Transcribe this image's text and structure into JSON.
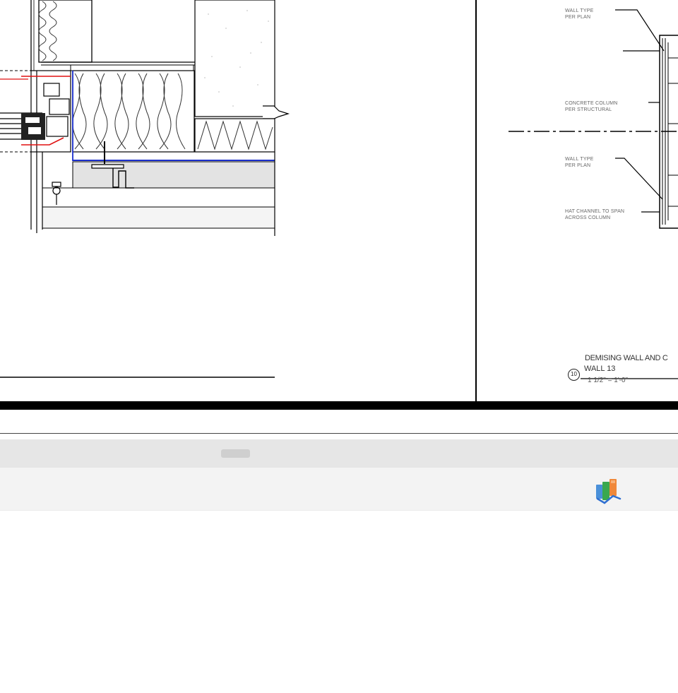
{
  "drawing": {
    "notes": {
      "wall_type_1_line1": "WALL TYPE",
      "wall_type_1_line2": "PER PLAN",
      "concrete_column_line1": "CONCRETE COLUMN",
      "concrete_column_line2": "PER STRUCTURAL",
      "wall_type_2_line1": "WALL TYPE",
      "wall_type_2_line2": "PER PLAN",
      "hat_channel_line1": "HAT CHANNEL TO SPAN",
      "hat_channel_line2": "ACROSS COLUMN"
    },
    "detail_title": {
      "callout_number": "10",
      "title": "DEMISING WALL AND C",
      "subtitle": "WALL 13",
      "scale": "1 1/2\" = 1'-0\""
    }
  },
  "colors": {
    "line": "#000000",
    "insulation_line": "#333333",
    "flashing_red": "#e01010",
    "membrane_blue": "#1a2ecc",
    "concrete_fill": "#e3e3e3",
    "toolbar_bg": "#f3f3f3",
    "scroll_track": "#e6e6e6"
  },
  "toolbar": {
    "app_icon": "building-model-icon"
  }
}
